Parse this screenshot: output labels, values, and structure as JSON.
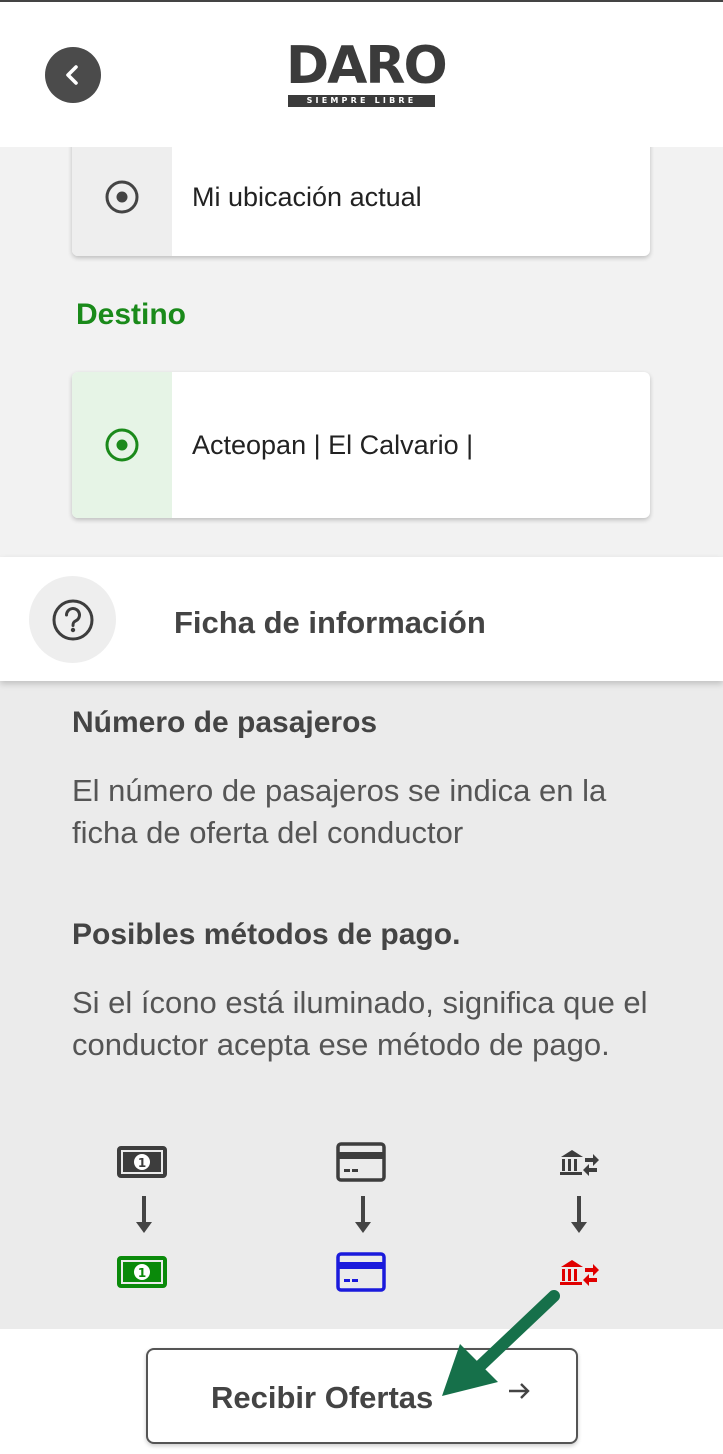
{
  "header": {
    "back_icon": "chevron-left-icon",
    "logo_word": "DARO",
    "logo_tagline": "SIEMPRE LIBRE"
  },
  "origin": {
    "value": "Mi ubicación actual",
    "icon": "radio-target-icon"
  },
  "destination": {
    "label": "Destino",
    "value": "Acteopan | El Calvario |",
    "icon": "radio-target-icon",
    "accent": "#1a8a1a"
  },
  "info_bar": {
    "icon": "question-circle-icon",
    "title": "Ficha de información"
  },
  "info": {
    "passengers_heading": "Número de pasajeros",
    "passengers_text": "El número de pasajeros se indica en la ficha de oferta del conductor",
    "payment_heading": "Posibles métodos de pago.",
    "payment_text": "Si el ícono está iluminado, significa que el conductor acepta ese método de pago."
  },
  "payment_methods": [
    {
      "icon": "cash-icon",
      "inactive_color": "#3d3d3d",
      "active_color": "#0a8a0a"
    },
    {
      "icon": "credit-card-icon",
      "inactive_color": "#3d3d3d",
      "active_color": "#1a1adc"
    },
    {
      "icon": "bank-transfer-icon",
      "inactive_color": "#3d3d3d",
      "active_color": "#e00000"
    }
  ],
  "actions": {
    "offers_label": "Recibir Ofertas",
    "offers_icon": "arrow-right-icon"
  },
  "annotation": {
    "pointer_icon": "green-pointer-arrow-icon",
    "pointer_color": "#16704a"
  }
}
